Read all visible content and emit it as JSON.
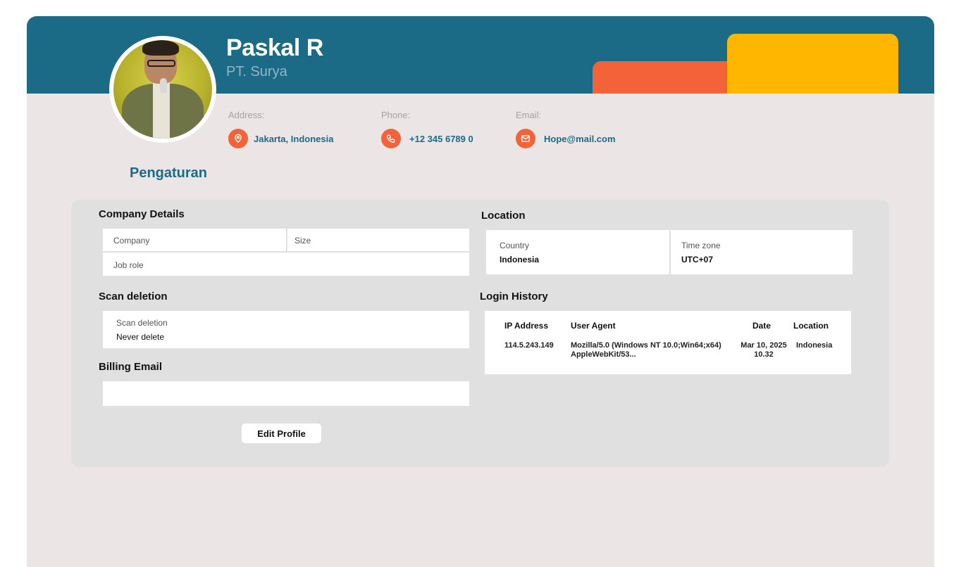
{
  "profile": {
    "name": "Paskal R",
    "company": "PT. Surya",
    "address_label": "Address:",
    "address": "Jakarta, Indonesia",
    "phone_label": "Phone:",
    "phone": "+12 345 6789 0",
    "email_label": "Email:",
    "email": "Hope@mail.com"
  },
  "page": {
    "section_title": "Pengaturan"
  },
  "company_details": {
    "title": "Company Details",
    "company_label": "Company",
    "size_label": "Size",
    "job_role_label": "Job role"
  },
  "scan_deletion": {
    "title": "Scan deletion",
    "label": "Scan deletion",
    "value": "Never delete"
  },
  "billing_email": {
    "title": "Billing Email",
    "value": ""
  },
  "edit_button": "Edit Profile",
  "location": {
    "title": "Location",
    "country_label": "Country",
    "country": "Indonesia",
    "timezone_label": "Time zone",
    "timezone": "UTC+07"
  },
  "login_history": {
    "title": "Login History",
    "headers": [
      "IP Address",
      "User Agent",
      "Date",
      "Location"
    ],
    "rows": [
      {
        "ip": "114.5.243.149",
        "agent_line1": "Mozilla/5.0 (Windows NT 10.0;Win64;x64)",
        "agent_line2": "AppleWebKit/53...",
        "date_line1": "Mar 10, 2025",
        "date_line2": "10.32",
        "location": "Indonesia"
      }
    ]
  },
  "colors": {
    "banner": "#1b6b86",
    "accent_orange": "#f4623a",
    "accent_yellow": "#ffb600",
    "background": "#ece5e6",
    "panel": "#e1e0e0"
  }
}
